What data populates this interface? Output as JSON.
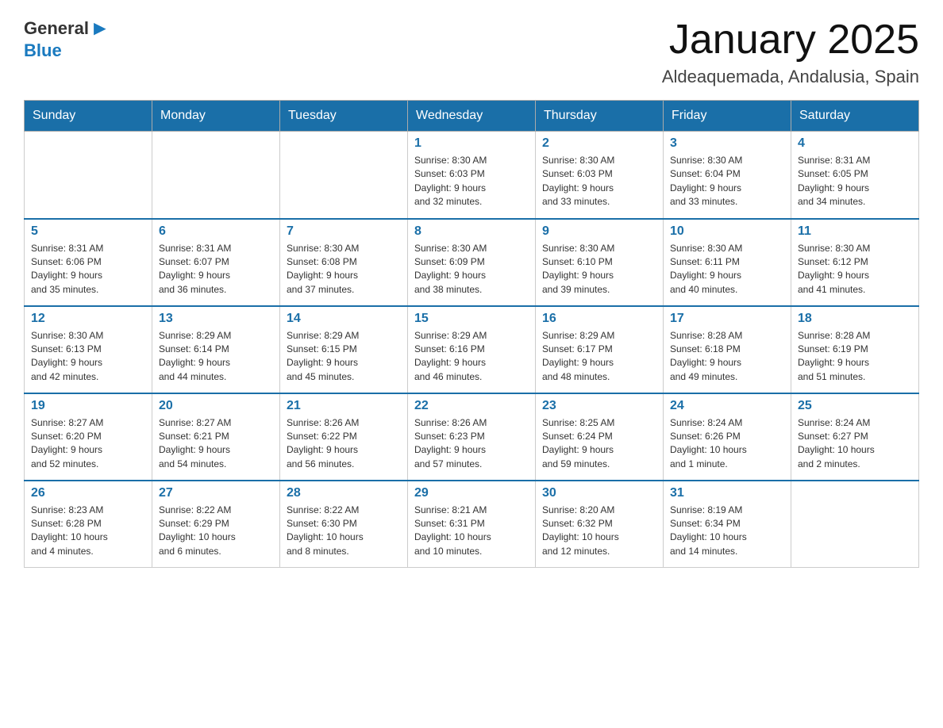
{
  "logo": {
    "general": "General",
    "blue": "Blue"
  },
  "title": "January 2025",
  "subtitle": "Aldeaquemada, Andalusia, Spain",
  "days_of_week": [
    "Sunday",
    "Monday",
    "Tuesday",
    "Wednesday",
    "Thursday",
    "Friday",
    "Saturday"
  ],
  "weeks": [
    [
      {
        "day": "",
        "info": ""
      },
      {
        "day": "",
        "info": ""
      },
      {
        "day": "",
        "info": ""
      },
      {
        "day": "1",
        "info": "Sunrise: 8:30 AM\nSunset: 6:03 PM\nDaylight: 9 hours\nand 32 minutes."
      },
      {
        "day": "2",
        "info": "Sunrise: 8:30 AM\nSunset: 6:03 PM\nDaylight: 9 hours\nand 33 minutes."
      },
      {
        "day": "3",
        "info": "Sunrise: 8:30 AM\nSunset: 6:04 PM\nDaylight: 9 hours\nand 33 minutes."
      },
      {
        "day": "4",
        "info": "Sunrise: 8:31 AM\nSunset: 6:05 PM\nDaylight: 9 hours\nand 34 minutes."
      }
    ],
    [
      {
        "day": "5",
        "info": "Sunrise: 8:31 AM\nSunset: 6:06 PM\nDaylight: 9 hours\nand 35 minutes."
      },
      {
        "day": "6",
        "info": "Sunrise: 8:31 AM\nSunset: 6:07 PM\nDaylight: 9 hours\nand 36 minutes."
      },
      {
        "day": "7",
        "info": "Sunrise: 8:30 AM\nSunset: 6:08 PM\nDaylight: 9 hours\nand 37 minutes."
      },
      {
        "day": "8",
        "info": "Sunrise: 8:30 AM\nSunset: 6:09 PM\nDaylight: 9 hours\nand 38 minutes."
      },
      {
        "day": "9",
        "info": "Sunrise: 8:30 AM\nSunset: 6:10 PM\nDaylight: 9 hours\nand 39 minutes."
      },
      {
        "day": "10",
        "info": "Sunrise: 8:30 AM\nSunset: 6:11 PM\nDaylight: 9 hours\nand 40 minutes."
      },
      {
        "day": "11",
        "info": "Sunrise: 8:30 AM\nSunset: 6:12 PM\nDaylight: 9 hours\nand 41 minutes."
      }
    ],
    [
      {
        "day": "12",
        "info": "Sunrise: 8:30 AM\nSunset: 6:13 PM\nDaylight: 9 hours\nand 42 minutes."
      },
      {
        "day": "13",
        "info": "Sunrise: 8:29 AM\nSunset: 6:14 PM\nDaylight: 9 hours\nand 44 minutes."
      },
      {
        "day": "14",
        "info": "Sunrise: 8:29 AM\nSunset: 6:15 PM\nDaylight: 9 hours\nand 45 minutes."
      },
      {
        "day": "15",
        "info": "Sunrise: 8:29 AM\nSunset: 6:16 PM\nDaylight: 9 hours\nand 46 minutes."
      },
      {
        "day": "16",
        "info": "Sunrise: 8:29 AM\nSunset: 6:17 PM\nDaylight: 9 hours\nand 48 minutes."
      },
      {
        "day": "17",
        "info": "Sunrise: 8:28 AM\nSunset: 6:18 PM\nDaylight: 9 hours\nand 49 minutes."
      },
      {
        "day": "18",
        "info": "Sunrise: 8:28 AM\nSunset: 6:19 PM\nDaylight: 9 hours\nand 51 minutes."
      }
    ],
    [
      {
        "day": "19",
        "info": "Sunrise: 8:27 AM\nSunset: 6:20 PM\nDaylight: 9 hours\nand 52 minutes."
      },
      {
        "day": "20",
        "info": "Sunrise: 8:27 AM\nSunset: 6:21 PM\nDaylight: 9 hours\nand 54 minutes."
      },
      {
        "day": "21",
        "info": "Sunrise: 8:26 AM\nSunset: 6:22 PM\nDaylight: 9 hours\nand 56 minutes."
      },
      {
        "day": "22",
        "info": "Sunrise: 8:26 AM\nSunset: 6:23 PM\nDaylight: 9 hours\nand 57 minutes."
      },
      {
        "day": "23",
        "info": "Sunrise: 8:25 AM\nSunset: 6:24 PM\nDaylight: 9 hours\nand 59 minutes."
      },
      {
        "day": "24",
        "info": "Sunrise: 8:24 AM\nSunset: 6:26 PM\nDaylight: 10 hours\nand 1 minute."
      },
      {
        "day": "25",
        "info": "Sunrise: 8:24 AM\nSunset: 6:27 PM\nDaylight: 10 hours\nand 2 minutes."
      }
    ],
    [
      {
        "day": "26",
        "info": "Sunrise: 8:23 AM\nSunset: 6:28 PM\nDaylight: 10 hours\nand 4 minutes."
      },
      {
        "day": "27",
        "info": "Sunrise: 8:22 AM\nSunset: 6:29 PM\nDaylight: 10 hours\nand 6 minutes."
      },
      {
        "day": "28",
        "info": "Sunrise: 8:22 AM\nSunset: 6:30 PM\nDaylight: 10 hours\nand 8 minutes."
      },
      {
        "day": "29",
        "info": "Sunrise: 8:21 AM\nSunset: 6:31 PM\nDaylight: 10 hours\nand 10 minutes."
      },
      {
        "day": "30",
        "info": "Sunrise: 8:20 AM\nSunset: 6:32 PM\nDaylight: 10 hours\nand 12 minutes."
      },
      {
        "day": "31",
        "info": "Sunrise: 8:19 AM\nSunset: 6:34 PM\nDaylight: 10 hours\nand 14 minutes."
      },
      {
        "day": "",
        "info": ""
      }
    ]
  ]
}
